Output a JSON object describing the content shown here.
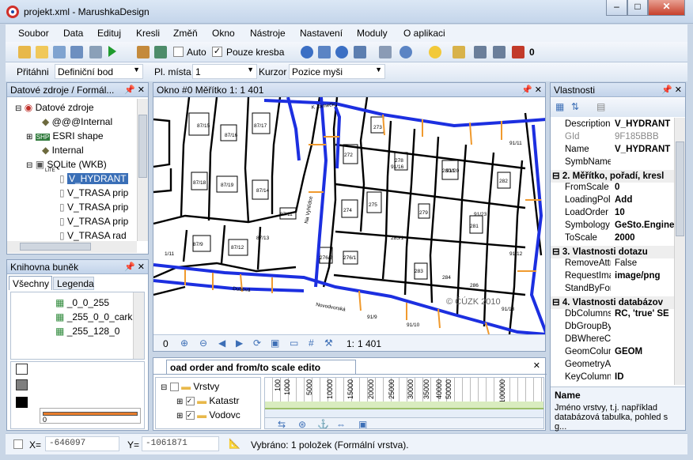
{
  "window": {
    "title": "projekt.xml - MarushkaDesign",
    "min": "–",
    "max": "□",
    "close": "✕"
  },
  "menu": [
    "Soubor",
    "Data",
    "Edituj",
    "Kresli",
    "Změň",
    "Okno",
    "Nástroje",
    "Nastavení",
    "Moduly",
    "O aplikaci"
  ],
  "toolbar": {
    "auto_label": "Auto",
    "pouze_kresba_label": "Pouze kresba",
    "count": "0"
  },
  "toolbar2": {
    "pritahni_label": "Přitáhni",
    "pritahni_value": "Definiční bod",
    "pl_mista_label": "Pl. místa",
    "pl_mista_value": "1",
    "kurzor_label": "Kurzor",
    "kurzor_value": "Pozice myši"
  },
  "datasources": {
    "title": "Datové zdroje / Formál...",
    "items": [
      "Datové zdroje",
      "@@@Internal",
      "ESRI shape",
      "Internal",
      "SQLite (WKB)",
      "V_HYDRANT",
      "V_TRASA prip",
      "V_TRASA prip",
      "V_TRASA prip",
      "V_TRASA rad"
    ],
    "shp": "SHP",
    "lite": "LITE"
  },
  "cells": {
    "title": "Knihovna buněk",
    "tab_all": "Všechny",
    "tab_legend": "Legenda",
    "items": [
      "_0_0_255",
      "_255_0_0_cark",
      "_255_128_0"
    ],
    "preview_num": "0"
  },
  "map": {
    "title": "Okno #0 Měřítko 1:  1 401",
    "scale_label": "1:",
    "scale_value": "1 401",
    "zoom_value": "0",
    "copyright": "© ČÚZK 2010",
    "labels": [
      "K Zámečku",
      "Na Vyhlídce",
      "Novodvorská",
      "Dubová",
      "87/15",
      "87/16",
      "87/17",
      "87/18",
      "87/19",
      "91/16",
      "91/20",
      "91/23",
      "272",
      "273",
      "274",
      "275",
      "276/1",
      "276/2",
      "278",
      "279",
      "280/1",
      "281",
      "282",
      "283",
      "284",
      "285/1",
      "286",
      "87/9",
      "87/12",
      "87/14",
      "87/11",
      "87/13",
      "91/9",
      "91/10",
      "91/11",
      "91/12",
      "91/13",
      "1/11"
    ]
  },
  "layerload": {
    "title": "oad order and from/to scale edito",
    "layers": [
      "Vrstvy",
      "Katastr",
      "Vodovc"
    ],
    "ticks": [
      "100",
      "1000",
      "5000",
      "10000",
      "15000",
      "20000",
      "25000",
      "30000",
      "35000",
      "40000",
      "50000",
      "100000"
    ]
  },
  "properties": {
    "title": "Vlastnosti",
    "rows": [
      {
        "n": "Description",
        "v": "V_HYDRANT",
        "bold": true
      },
      {
        "n": "GId",
        "v": "9F185BBB",
        "bold": false,
        "grey": true
      },
      {
        "n": "Name",
        "v": "V_HYDRANT",
        "bold": true
      },
      {
        "n": "SymbName",
        "v": "",
        "bold": false
      },
      {
        "cat": "2. Měřítko, pořadí, kresl"
      },
      {
        "n": "FromScale",
        "v": "0",
        "bold": true
      },
      {
        "n": "LoadingPolic",
        "v": "Add",
        "bold": true
      },
      {
        "n": "LoadOrder",
        "v": "10",
        "bold": true
      },
      {
        "n": "Symbology",
        "v": "GeSto.Engine",
        "bold": true
      },
      {
        "n": "ToScale",
        "v": "2000",
        "bold": true
      },
      {
        "cat": "3. Vlastnosti dotazu"
      },
      {
        "n": "RemoveAttri",
        "v": "False",
        "bold": false
      },
      {
        "n": "RequestIma",
        "v": "image/png",
        "bold": true
      },
      {
        "n": "StandByFor",
        "v": "",
        "bold": false
      },
      {
        "cat": "4. Vlastnosti databázov"
      },
      {
        "n": "DbColumns",
        "v": "RC, 'true' SE",
        "bold": true
      },
      {
        "n": "DbGroupByC",
        "v": "",
        "bold": false
      },
      {
        "n": "DBWhereCl",
        "v": "",
        "bold": false
      },
      {
        "n": "GeomColum",
        "v": "GEOM",
        "bold": true
      },
      {
        "n": "GeometryAg",
        "v": "",
        "bold": false
      },
      {
        "n": "KeyColumn",
        "v": "ID",
        "bold": true
      }
    ],
    "help_title": "Name",
    "help_text": "Jméno vrstvy, t.j. například databázová tabulka, pohled s g..."
  },
  "status": {
    "x_label": "X=",
    "x_value": "-646097",
    "y_label": "Y=",
    "y_value": "-1061871",
    "selection": "Vybráno: 1  položek (Formální vrstva)."
  }
}
